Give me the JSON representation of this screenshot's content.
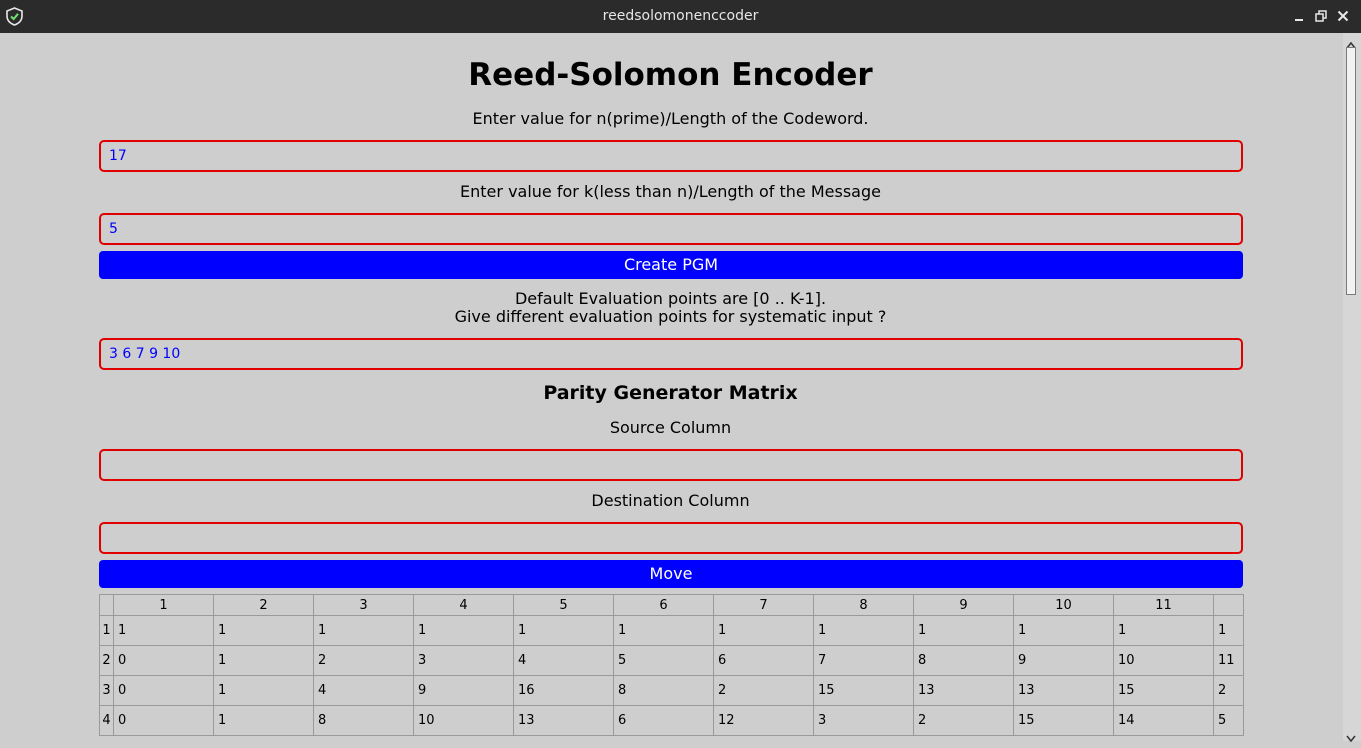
{
  "window": {
    "title": "reedsolomonenccoder"
  },
  "icons": {
    "app": "shield-check-icon",
    "minimize": "minimize-icon",
    "maximize": "restore-icon",
    "close": "close-icon"
  },
  "colors": {
    "button": "#0000ff",
    "field_border": "#e00000",
    "field_text": "#0000ff",
    "background": "#cecece"
  },
  "heading": "Reed-Solomon Encoder",
  "n_label": "Enter value for n(prime)/Length of the Codeword.",
  "n_value": "17",
  "k_label": "Enter value for k(less than n)/Length of the Message",
  "k_value": "5",
  "create_button": "Create PGM",
  "eval_label_line1": "Default Evaluation points are [0 .. K-1].",
  "eval_label_line2": "Give different evaluation points for systematic input ?",
  "eval_value": "3 6 7 9 10",
  "matrix_heading": "Parity Generator Matrix",
  "source_label": "Source Column",
  "source_value": "",
  "dest_label": "Destination Column",
  "dest_value": "",
  "move_button": "Move",
  "table": {
    "columns": [
      "1",
      "2",
      "3",
      "4",
      "5",
      "6",
      "7",
      "8",
      "9",
      "10",
      "11",
      ""
    ],
    "rows": [
      {
        "header": "1",
        "cells": [
          "1",
          "1",
          "1",
          "1",
          "1",
          "1",
          "1",
          "1",
          "1",
          "1",
          "1",
          "1"
        ]
      },
      {
        "header": "2",
        "cells": [
          "0",
          "1",
          "2",
          "3",
          "4",
          "5",
          "6",
          "7",
          "8",
          "9",
          "10",
          "11"
        ]
      },
      {
        "header": "3",
        "cells": [
          "0",
          "1",
          "4",
          "9",
          "16",
          "8",
          "2",
          "15",
          "13",
          "13",
          "15",
          "2"
        ]
      },
      {
        "header": "4",
        "cells": [
          "0",
          "1",
          "8",
          "10",
          "13",
          "6",
          "12",
          "3",
          "2",
          "15",
          "14",
          "5"
        ]
      }
    ]
  }
}
